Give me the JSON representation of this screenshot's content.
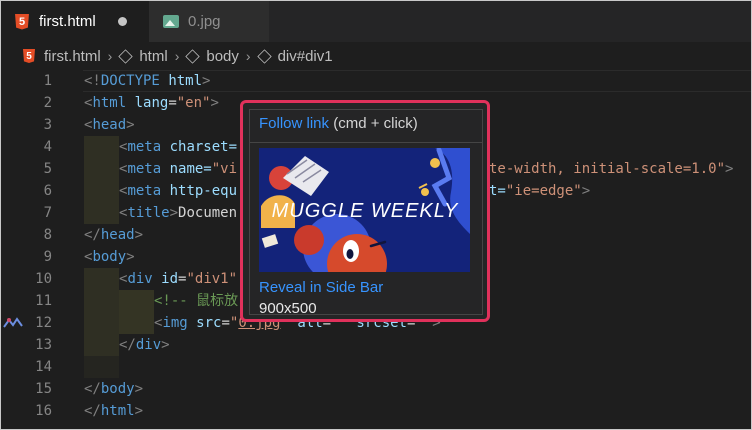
{
  "tabs": [
    {
      "label": "first.html",
      "icon": "html5-icon",
      "dirty": true
    },
    {
      "label": "0.jpg",
      "icon": "image-icon"
    }
  ],
  "html5_glyph": "5",
  "breadcrumb": [
    "first.html",
    "html",
    "body",
    "div#div1"
  ],
  "hover": {
    "follow_link": "Follow link",
    "follow_hint": " (cmd + click)",
    "image_text": "MUGGLE WEEKLY",
    "reveal": "Reveal in Side Bar",
    "dims": "900x500"
  },
  "lines": {
    "1": {
      "num": "1",
      "p1": "<!",
      "p2": "DOCTYPE",
      "p3": " ",
      "p4": "html",
      "p5": ">"
    },
    "2": {
      "num": "2",
      "p1": "<",
      "p2": "html",
      "p3": " ",
      "p4": "lang",
      "p5": "=",
      "p6": "\"en\"",
      "p7": ">"
    },
    "3": {
      "num": "3",
      "p1": "<",
      "p2": "head",
      "p3": ">"
    },
    "4": {
      "num": "4",
      "p1": "<",
      "p2": "meta",
      "p3": " ",
      "p4": "charset="
    },
    "5": {
      "num": "5",
      "p1": "<",
      "p2": "meta",
      "p3": " ",
      "p4": "name=",
      "p5": "\"vi",
      "p6": "te-width, initial-scale=1.0\"",
      "p7": ">"
    },
    "6": {
      "num": "6",
      "p1": "<",
      "p2": "meta",
      "p3": " ",
      "p4": "http-equ",
      "p5": "t=",
      "p6": "\"ie=edge\"",
      "p7": ">"
    },
    "7": {
      "num": "7",
      "p1": "<",
      "p2": "title",
      "p3": ">",
      "p4": "Documen"
    },
    "8": {
      "num": "8",
      "p1": "</",
      "p2": "head",
      "p3": ">"
    },
    "9": {
      "num": "9",
      "p1": "<",
      "p2": "body",
      "p3": ">"
    },
    "10": {
      "num": "10",
      "p1": "<",
      "p2": "div",
      "p3": " ",
      "p4": "id",
      "p5": "=",
      "p6": "\"div1\""
    },
    "11": {
      "num": "11",
      "p1": "<!-- 鼠标放"
    },
    "12": {
      "num": "12",
      "p1": "<",
      "p2": "img",
      "p3": " ",
      "p4": "src",
      "p5": "=",
      "p6": "\"",
      "p7": "0.jpg",
      "p8": "\"",
      "p9": " ",
      "p10": "alt",
      "p11": "=",
      "p12": "\"\"",
      "p13": " ",
      "p14": "srcset",
      "p15": "=",
      "p16": "\"\"",
      "p17": ">"
    },
    "13": {
      "num": "13",
      "p1": "</",
      "p2": "div",
      "p3": ">"
    },
    "14": {
      "num": "14"
    },
    "15": {
      "num": "15",
      "p1": "</",
      "p2": "body",
      "p3": ">"
    },
    "16": {
      "num": "16",
      "p1": "</",
      "p2": "html",
      "p3": ">"
    }
  }
}
